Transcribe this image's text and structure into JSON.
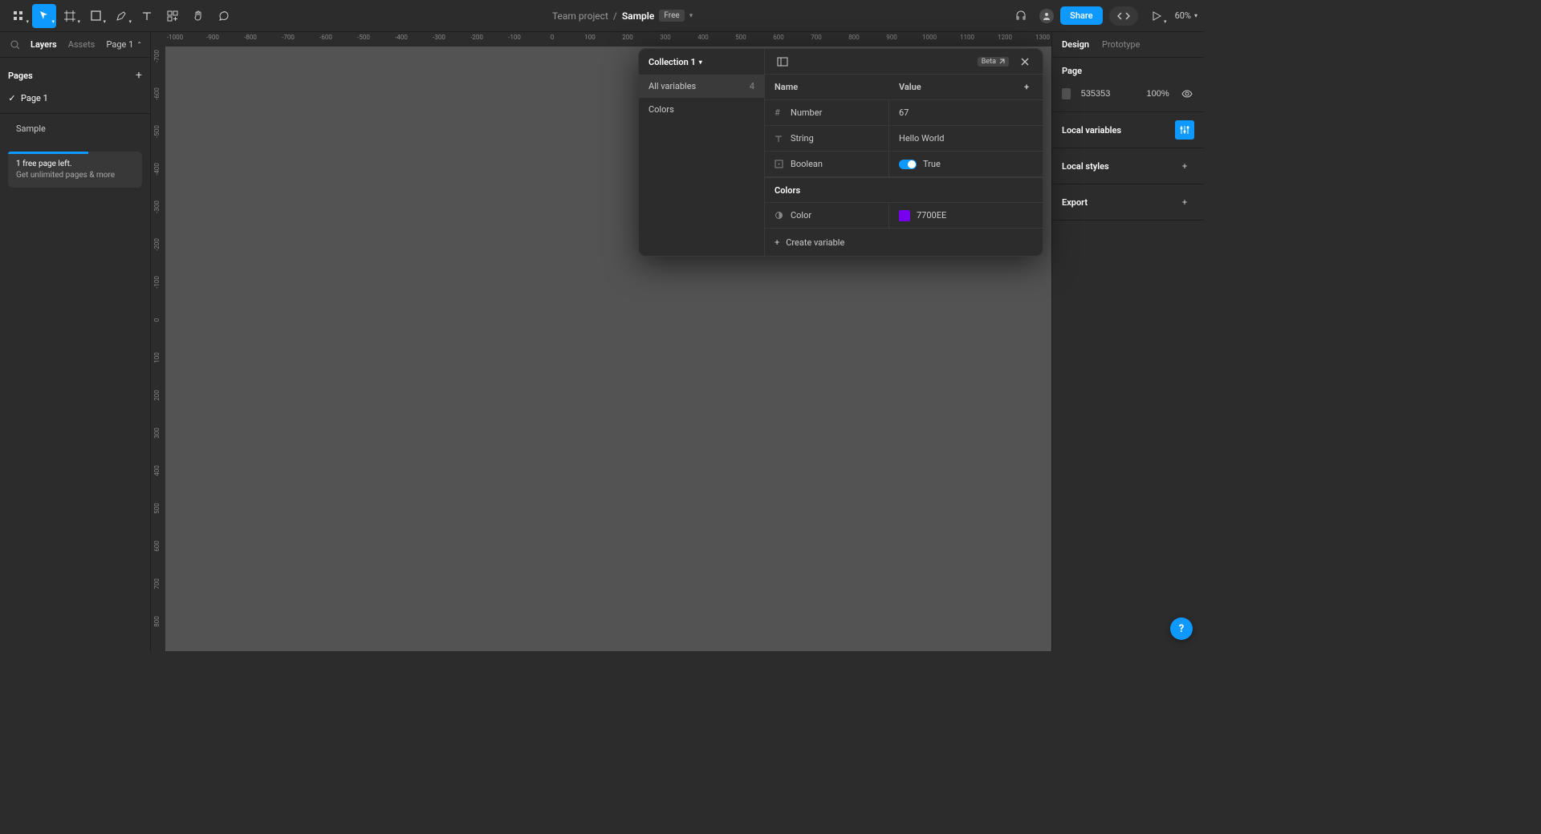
{
  "toolbar": {
    "project": "Team project",
    "sep": "/",
    "file": "Sample",
    "plan": "Free",
    "share": "Share",
    "zoom": "60%"
  },
  "left": {
    "tabs": {
      "layers": "Layers",
      "assets": "Assets"
    },
    "page_indicator": "Page 1",
    "pages_title": "Pages",
    "pages": [
      "Page 1"
    ],
    "layers": [
      "Sample"
    ],
    "upsell": {
      "line1": "1 free page left.",
      "line2": "Get unlimited pages & more"
    }
  },
  "right": {
    "tabs": {
      "design": "Design",
      "prototype": "Prototype"
    },
    "page": {
      "title": "Page",
      "bg_hex": "535353",
      "bg_opacity": "100%"
    },
    "local_variables": "Local variables",
    "local_styles": "Local styles",
    "export": "Export"
  },
  "ruler_h": [
    "-1000",
    "-900",
    "-800",
    "-700",
    "-600",
    "-500",
    "-400",
    "-300",
    "-200",
    "-100",
    "0",
    "100",
    "200",
    "300",
    "400",
    "500",
    "600",
    "700",
    "800",
    "900",
    "1000",
    "1100",
    "1200",
    "1300"
  ],
  "ruler_v": [
    "-700",
    "-600",
    "-500",
    "-400",
    "-300",
    "-200",
    "-100",
    "0",
    "100",
    "200",
    "300",
    "400",
    "500",
    "600",
    "700",
    "800"
  ],
  "variables": {
    "collection": "Collection 1",
    "beta": "Beta",
    "groups": [
      {
        "name": "All variables",
        "count": "4",
        "active": true
      },
      {
        "name": "Colors",
        "count": "",
        "active": false
      }
    ],
    "columns": {
      "name": "Name",
      "value": "Value"
    },
    "section_colors": "Colors",
    "rows": [
      {
        "type": "number",
        "name": "Number",
        "value": "67"
      },
      {
        "type": "string",
        "name": "String",
        "value": "Hello World"
      },
      {
        "type": "boolean",
        "name": "Boolean",
        "value": "True"
      }
    ],
    "color_row": {
      "name": "Color",
      "value": "7700EE",
      "swatch": "#7700EE"
    },
    "create": "Create variable"
  },
  "help": "?"
}
